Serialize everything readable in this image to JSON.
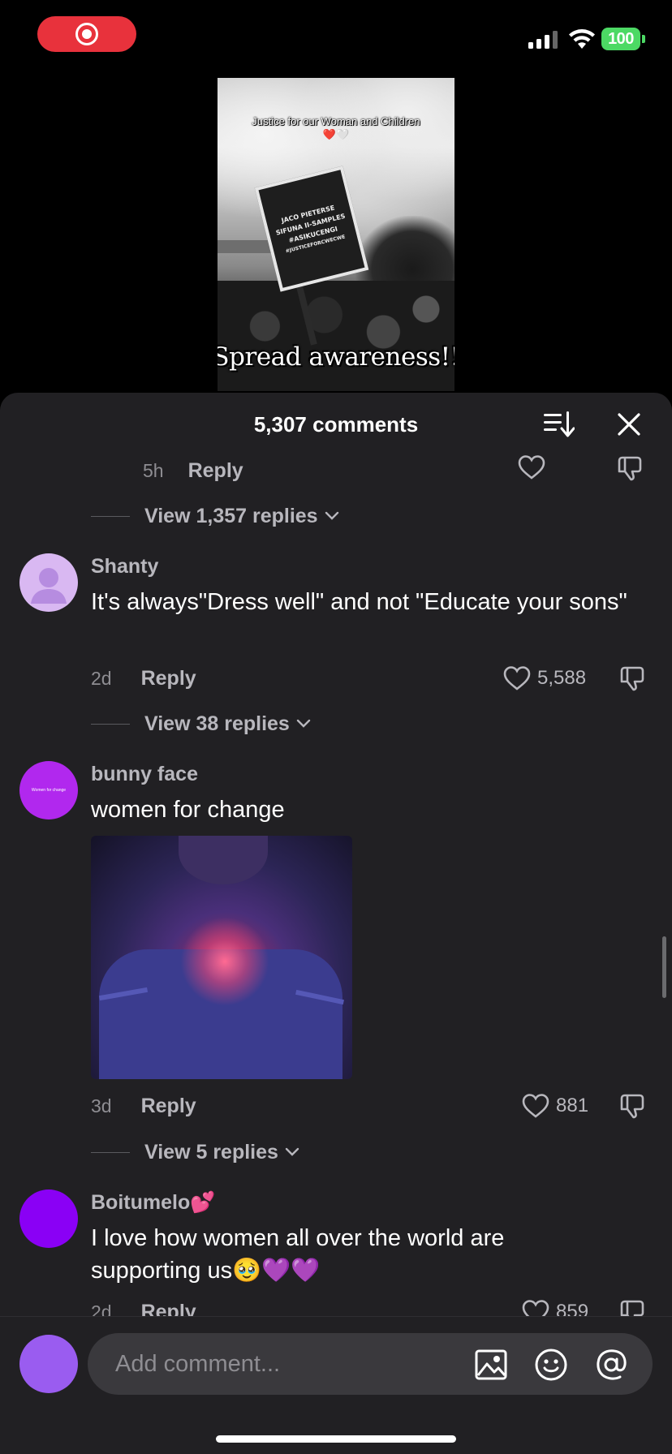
{
  "status_bar": {
    "battery": "100",
    "icons": [
      "screen-record-icon",
      "signal-icon",
      "wifi-icon",
      "battery-icon"
    ]
  },
  "video": {
    "caption_top": "Justice for our Woman and Children",
    "caption_top_emoji": "❤️🤍",
    "caption_bottom": "Spread awareness!!",
    "sign_lines": [
      "JACO PIETERSE",
      "SIFUNA II-SAMPLES",
      "#ASIKUCENGI",
      "#JUSTICEFORCWECWE"
    ]
  },
  "comments_header": {
    "count_label": "5,307 comments"
  },
  "list": {
    "partial": {
      "age": "5h",
      "reply_label": "Reply",
      "view_replies": "View 1,357 replies"
    },
    "comments": [
      {
        "username": "Shanty",
        "text": "It's always\"Dress well\" and not \"Educate your sons\"",
        "age": "2d",
        "reply_label": "Reply",
        "likes": "5,588",
        "view_replies": "View 38 replies",
        "avatar_color": "#d9b8f2"
      },
      {
        "username": "bunny face",
        "text": "women for change",
        "avatar_text": "Women for change",
        "age": "3d",
        "reply_label": "Reply",
        "likes": "881",
        "view_replies": "View 5 replies",
        "avatar_color": "#b128ee"
      },
      {
        "username": "Boitumelo💕",
        "text": "I love how women all over the world are supporting us🥹💜💜",
        "age": "2d",
        "reply_label": "Reply",
        "likes": "859",
        "avatar_color": "#8a00f5"
      }
    ]
  },
  "input": {
    "placeholder": "Add comment...",
    "icons": [
      "image-icon",
      "emoji-icon",
      "mention-icon"
    ]
  },
  "colors": {
    "sheet_bg": "#212023",
    "record": "#e8323c",
    "battery": "#4cd964"
  }
}
